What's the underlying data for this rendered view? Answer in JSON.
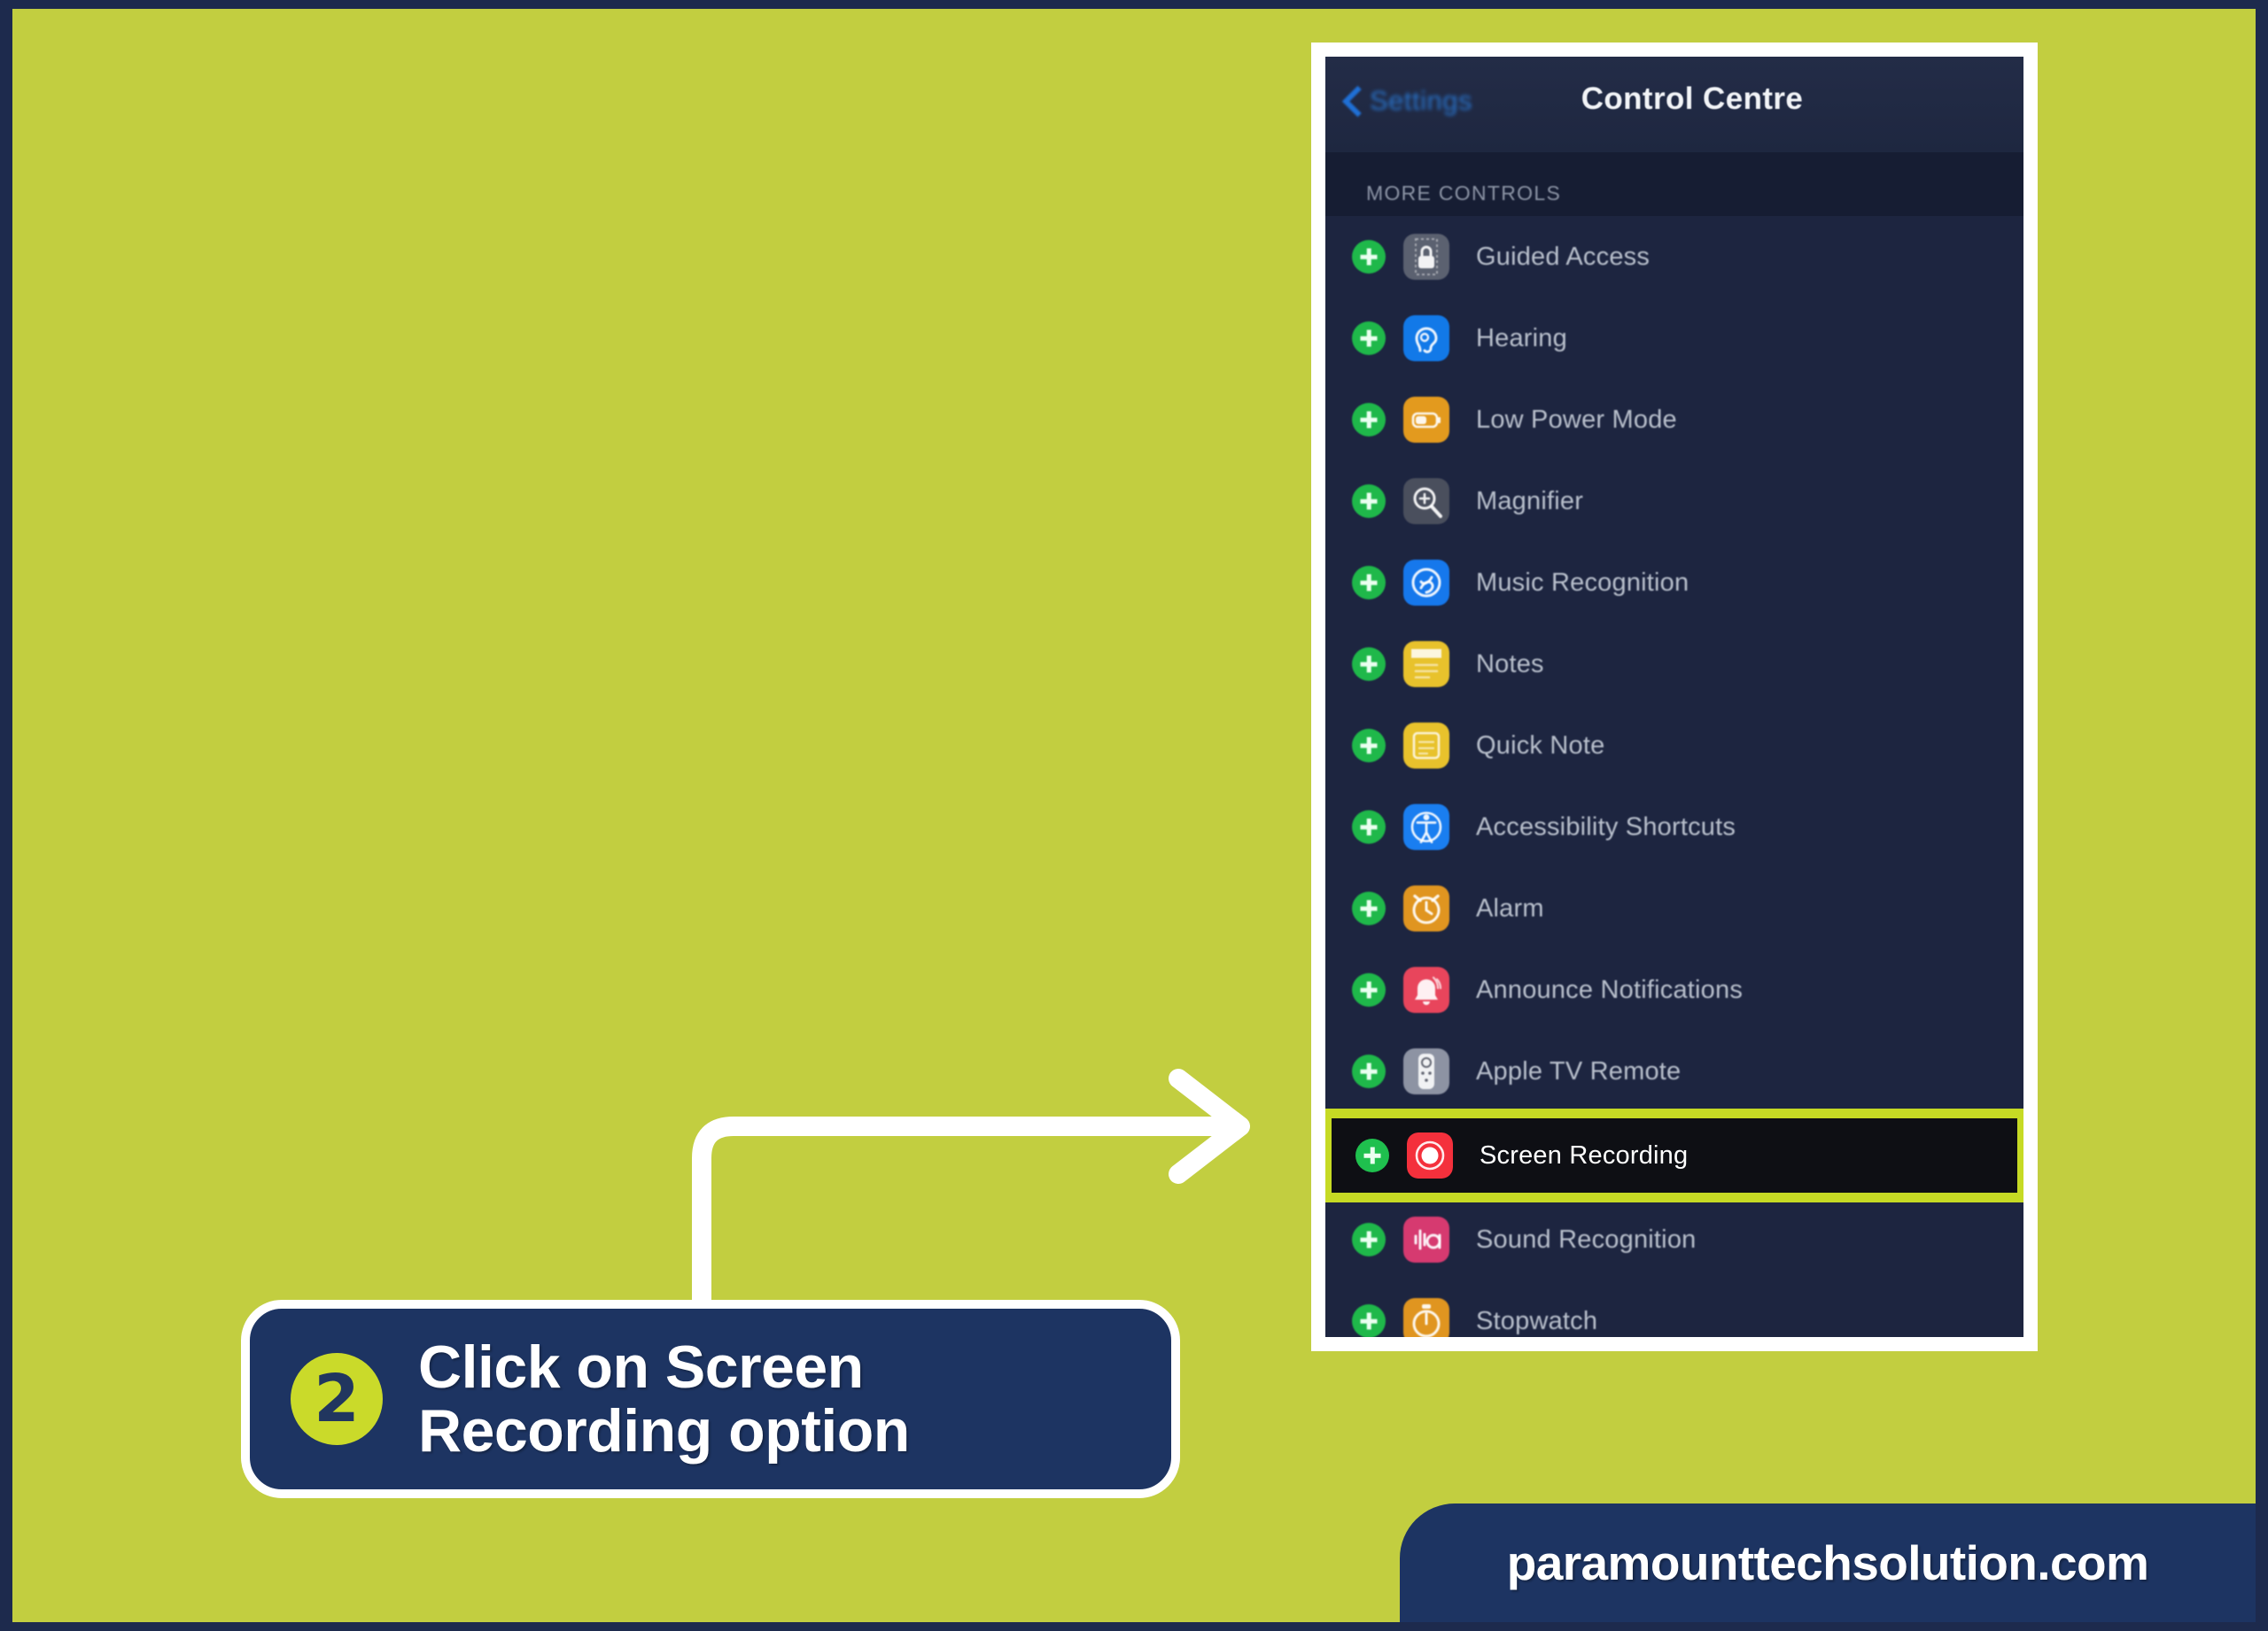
{
  "theme": {
    "background_green": "#C2CE40",
    "navy": "#1D3462",
    "frame_navy": "#1D2A4D",
    "highlight_yellow": "#C6DA24",
    "panel_dark": "#1D2540",
    "add_button_green": "#1FB84A"
  },
  "phone": {
    "nav": {
      "back_label": "Settings",
      "back_icon": "chevron-left-icon",
      "title": "Control Centre"
    },
    "section_header": "MORE CONTROLS",
    "controls": [
      {
        "label": "Guided Access",
        "icon": "lock-icon",
        "icon_color": "#5b6170",
        "add_icon": "plus-icon",
        "highlighted": false
      },
      {
        "label": "Hearing",
        "icon": "ear-icon",
        "icon_color": "#1279e8",
        "add_icon": "plus-icon",
        "highlighted": false
      },
      {
        "label": "Low Power Mode",
        "icon": "battery-icon",
        "icon_color": "#e39a1e",
        "add_icon": "plus-icon",
        "highlighted": false
      },
      {
        "label": "Magnifier",
        "icon": "magnifier-icon",
        "icon_color": "#4a4f5d",
        "add_icon": "plus-icon",
        "highlighted": false
      },
      {
        "label": "Music Recognition",
        "icon": "shazam-icon",
        "icon_color": "#1678ec",
        "add_icon": "plus-icon",
        "highlighted": false
      },
      {
        "label": "Notes",
        "icon": "notes-icon",
        "icon_color": "#e8c22c",
        "add_icon": "plus-icon",
        "highlighted": false
      },
      {
        "label": "Quick Note",
        "icon": "quick-note-icon",
        "icon_color": "#e8c22c",
        "add_icon": "plus-icon",
        "highlighted": false
      },
      {
        "label": "Accessibility Shortcuts",
        "icon": "accessibility-icon",
        "icon_color": "#1a7ef0",
        "add_icon": "plus-icon",
        "highlighted": false
      },
      {
        "label": "Alarm",
        "icon": "alarm-clock-icon",
        "icon_color": "#e09520",
        "add_icon": "plus-icon",
        "highlighted": false
      },
      {
        "label": "Announce Notifications",
        "icon": "bell-icon",
        "icon_color": "#e8455c",
        "add_icon": "plus-icon",
        "highlighted": false
      },
      {
        "label": "Apple TV Remote",
        "icon": "tv-remote-icon",
        "icon_color": "#8d93a3",
        "add_icon": "plus-icon",
        "highlighted": false
      },
      {
        "label": "Screen Recording",
        "icon": "record-icon",
        "icon_color": "#f4303c",
        "add_icon": "plus-icon",
        "highlighted": true
      },
      {
        "label": "Sound Recognition",
        "icon": "waveform-icon",
        "icon_color": "#d63a70",
        "add_icon": "plus-icon",
        "highlighted": false
      },
      {
        "label": "Stopwatch",
        "icon": "stopwatch-icon",
        "icon_color": "#e09520",
        "add_icon": "plus-icon",
        "highlighted": false
      }
    ]
  },
  "annotation": {
    "arrow_icon": "curved-arrow-right-icon",
    "step_number": "2",
    "text_line_1": "Click on Screen",
    "text_line_2": "Recording option"
  },
  "footer": {
    "website": "paramounttechsolution.com"
  }
}
